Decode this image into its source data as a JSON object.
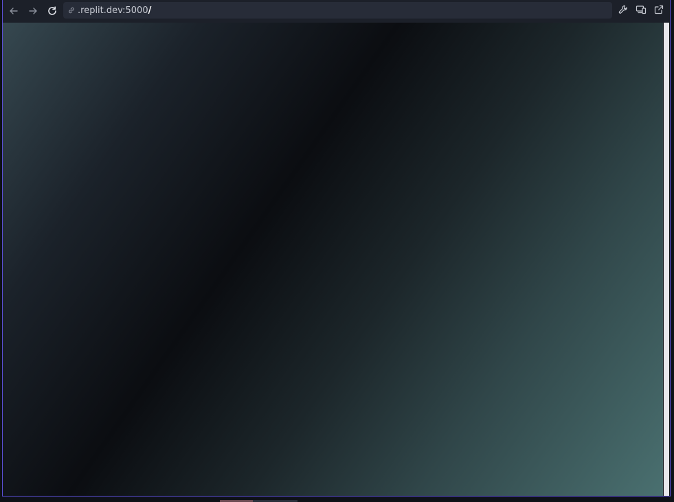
{
  "browser": {
    "url_host": ".replit.dev:5000",
    "url_path": "/",
    "icons": {
      "back": "arrow-left-icon",
      "forward": "arrow-right-icon",
      "reload": "reload-icon",
      "link": "link-icon",
      "tools": "wrench-icon",
      "devices": "devices-icon",
      "new_tab": "external-link-icon"
    }
  },
  "colors": {
    "frame_border": "#5b4fd6",
    "toolbar_bg": "#1c2029",
    "url_bar_bg": "#272c38",
    "gradient_start": "#364850",
    "gradient_dark": "#0b0d11",
    "gradient_end": "#4a7070"
  }
}
